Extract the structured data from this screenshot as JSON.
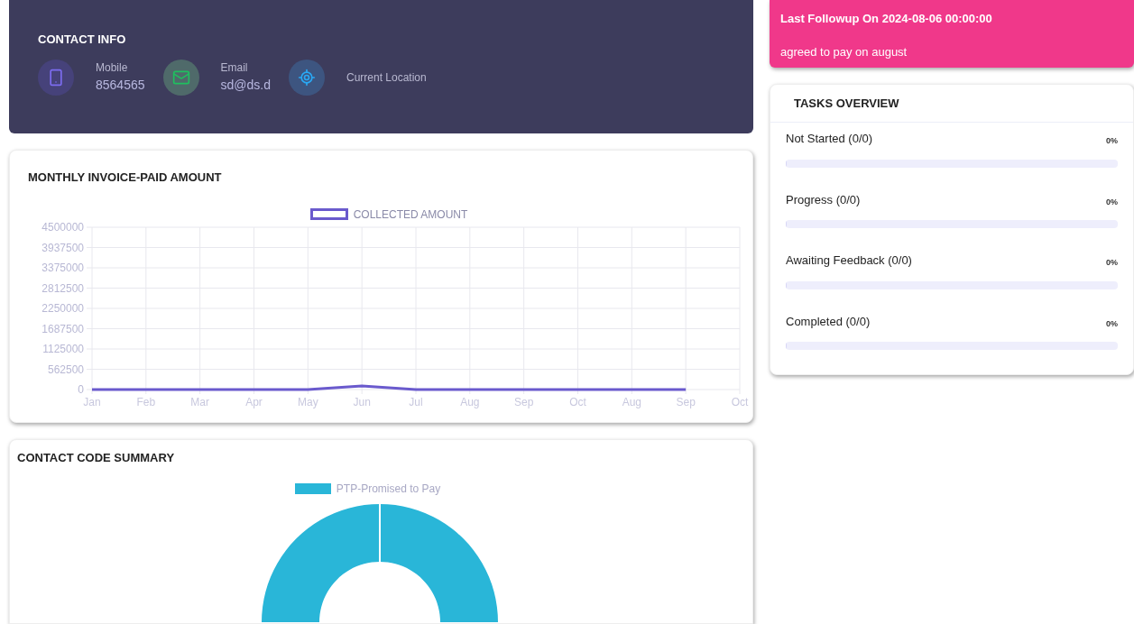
{
  "contact_info": {
    "title": "CONTACT INFO",
    "items": [
      {
        "kind": "phone",
        "label": "Mobile",
        "value": "8564565"
      },
      {
        "kind": "email",
        "label": "Email",
        "value": "sd@ds.d"
      },
      {
        "kind": "location",
        "label": "Current Location"
      }
    ]
  },
  "followup": {
    "title": "Last Followup On 2024-08-06 00:00:00",
    "note": "agreed to pay on august"
  },
  "invoice_chart": {
    "title": "MONTHLY INVOICE-PAID AMOUNT",
    "chart_data": {
      "type": "line",
      "categories": [
        "Jan",
        "Feb",
        "Mar",
        "Apr",
        "May",
        "Jun",
        "Jul",
        "Aug",
        "Sep",
        "Oct",
        "Aug",
        "Sep",
        "Oct"
      ],
      "series": [
        {
          "name": "COLLECTED AMOUNT",
          "color": "#6a5acd",
          "values": [
            0,
            0,
            0,
            0,
            0,
            100000,
            0,
            0,
            0,
            0,
            0,
            0,
            null
          ]
        }
      ],
      "grid": true,
      "ylim": [
        0,
        4500000
      ],
      "yticks": [
        0,
        562500,
        1125000,
        1687500,
        2250000,
        2812500,
        3375000,
        3937500,
        4500000
      ]
    }
  },
  "contact_code_summary": {
    "title": "CONTACT CODE SUMMARY",
    "legend": [
      {
        "label": "PTP-Promised to Pay",
        "color": "#29b6d8"
      }
    ]
  },
  "tasks_overview": {
    "title": "TASKS OVERVIEW",
    "tasks": [
      {
        "label": "Not Started (0/0)",
        "percent": "0%",
        "level": 0
      },
      {
        "label": "Progress (0/0)",
        "percent": "0%",
        "level": 0
      },
      {
        "label": "Awaiting Feedback (0/0)",
        "percent": "0%",
        "level": 0
      },
      {
        "label": "Completed (0/0)",
        "percent": "0%",
        "level": 0
      }
    ]
  }
}
